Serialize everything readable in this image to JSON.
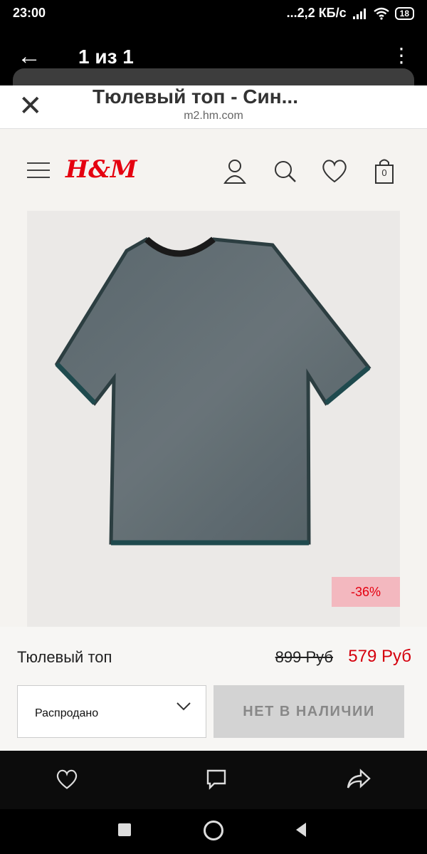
{
  "status_bar": {
    "time": "23:00",
    "network_speed": "...2,2 КБ/с",
    "battery": "18"
  },
  "viewer": {
    "counter": "1 из 1"
  },
  "browser": {
    "title": "Тюлевый топ - Син...",
    "url": "m2.hm.com"
  },
  "site": {
    "logo": "H&M",
    "icons": [
      "account-icon",
      "search-icon",
      "heart-icon",
      "bag-icon"
    ],
    "bag_count": "0",
    "brand_color": "#e50010"
  },
  "product": {
    "discount": "-36%",
    "name": "Тюлевый топ",
    "old_price": "899 Руб",
    "new_price": "579 Руб",
    "size_value": "Распродано",
    "availability_button": "НЕТ В НАЛИЧИИ"
  },
  "viewer_actions": [
    "heart-icon",
    "comment-icon",
    "share-icon"
  ]
}
